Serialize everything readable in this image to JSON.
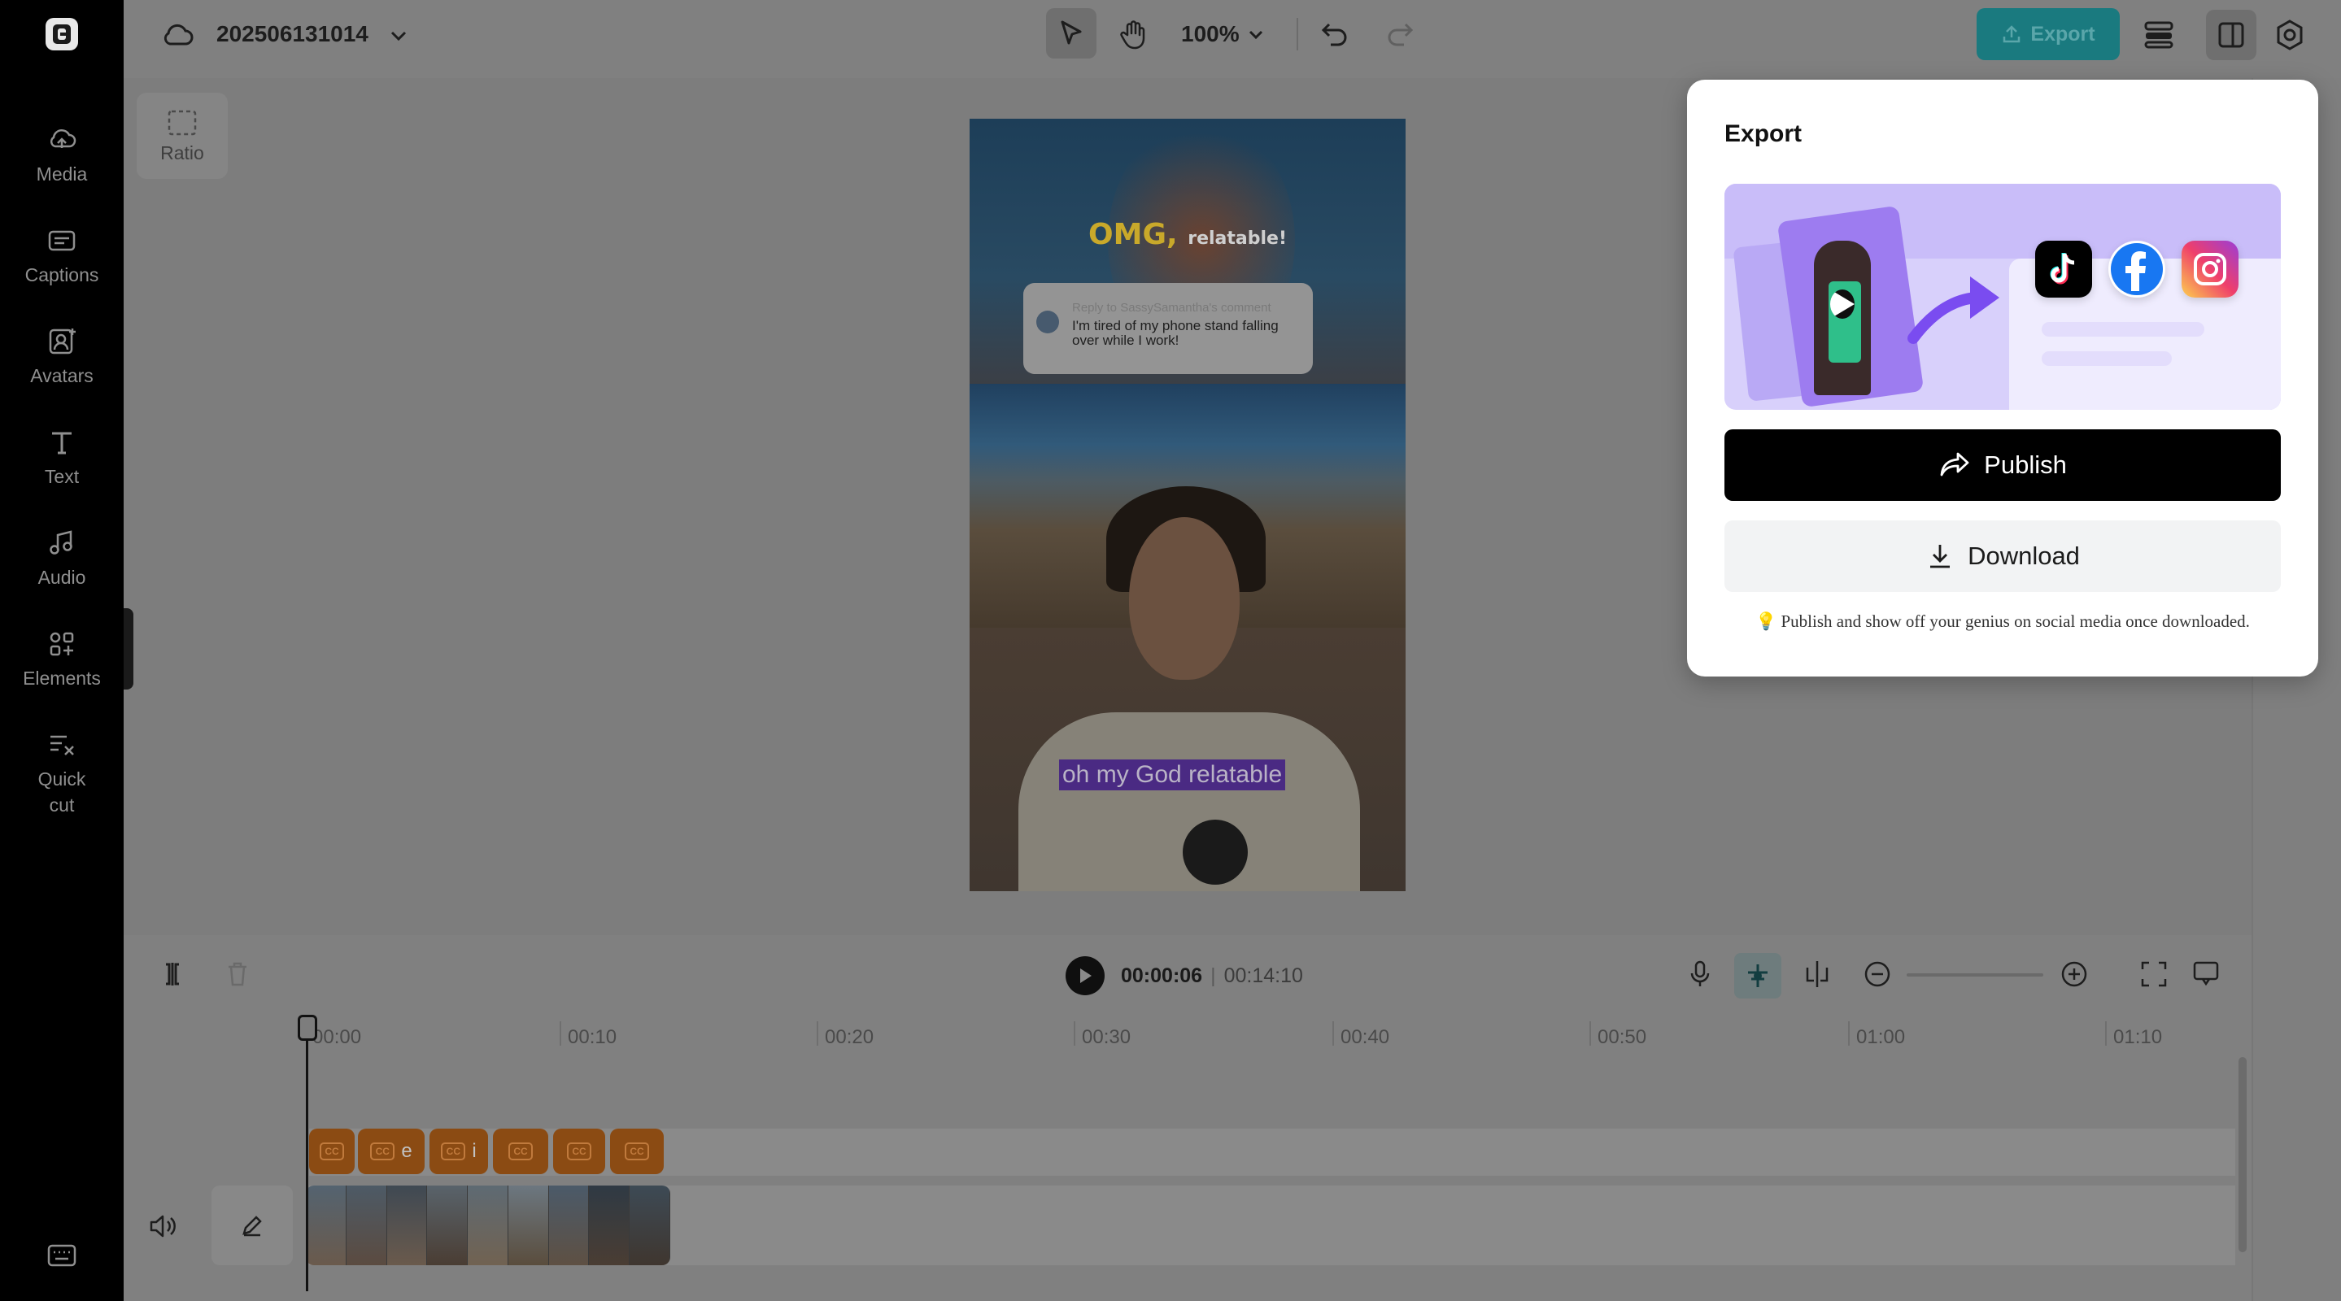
{
  "sidebar": {
    "items": [
      {
        "label": "Media",
        "icon": "cloud-media-icon"
      },
      {
        "label": "Captions",
        "icon": "captions-icon"
      },
      {
        "label": "Avatars",
        "icon": "avatar-icon"
      },
      {
        "label": "Text",
        "icon": "text-icon"
      },
      {
        "label": "Audio",
        "icon": "music-icon"
      },
      {
        "label": "Elements",
        "icon": "elements-icon"
      },
      {
        "label": "Quick cut",
        "icon": "quick-cut-icon"
      }
    ]
  },
  "topbar": {
    "project_name": "202506131014",
    "zoom": "100%",
    "export_label": "Export"
  },
  "canvas": {
    "ratio_label": "Ratio",
    "video": {
      "title_main": "OMG,",
      "title_sub": "relatable!",
      "comment_reply": "Reply to SassySamantha's comment",
      "comment_text": "I'm tired of my phone stand falling over while I work!",
      "caption": "oh my God relatable"
    }
  },
  "timeline": {
    "current_time": "00:00:06",
    "total_time": "00:14:10",
    "ruler": [
      "00:00",
      "00:10",
      "00:20",
      "00:30",
      "00:40",
      "00:50",
      "01:00",
      "01:10"
    ],
    "caption_chips": [
      {
        "letter": ""
      },
      {
        "letter": "e"
      },
      {
        "letter": "i"
      },
      {
        "letter": ""
      },
      {
        "letter": ""
      },
      {
        "letter": ""
      }
    ]
  },
  "export_popup": {
    "title": "Export",
    "publish_label": "Publish",
    "download_label": "Download",
    "tip": "Publish and show off your genius on social media once downloaded.",
    "tip_icon": "lightbulb-icon",
    "social_icons": [
      "tiktok-icon",
      "facebook-icon",
      "instagram-icon"
    ]
  },
  "colors": {
    "accent": "#1a7a7f",
    "caption_chip": "#8b4b13",
    "publish_bg": "#000000",
    "banner_bg": "#d8d0fb"
  }
}
